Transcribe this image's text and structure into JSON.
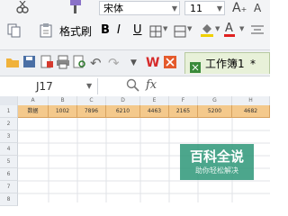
{
  "ribbon": {
    "format_painter_label": "格式刷",
    "font_name": "宋体",
    "font_size": "11"
  },
  "qat": {
    "tab_label": "工作簿1",
    "tab_suffix": "*"
  },
  "formula_bar": {
    "cell_ref": "J17",
    "fx_label": "fx"
  },
  "sheet": {
    "columns": [
      "A",
      "B",
      "C",
      "D",
      "E",
      "F",
      "G",
      "H"
    ],
    "rows": [
      "1",
      "2",
      "3",
      "4",
      "5",
      "6",
      "7",
      "8"
    ],
    "row1": [
      "数据",
      "1002",
      "7896",
      "6210",
      "4463",
      "2165",
      "5200",
      "4682"
    ]
  },
  "watermark": {
    "title": "百科全说",
    "subtitle": "助你轻松解决"
  },
  "colors": {
    "highlight": "#f4c98c",
    "tab_bg": "#e8f1d9",
    "watermark_bg": "#2d9678"
  }
}
